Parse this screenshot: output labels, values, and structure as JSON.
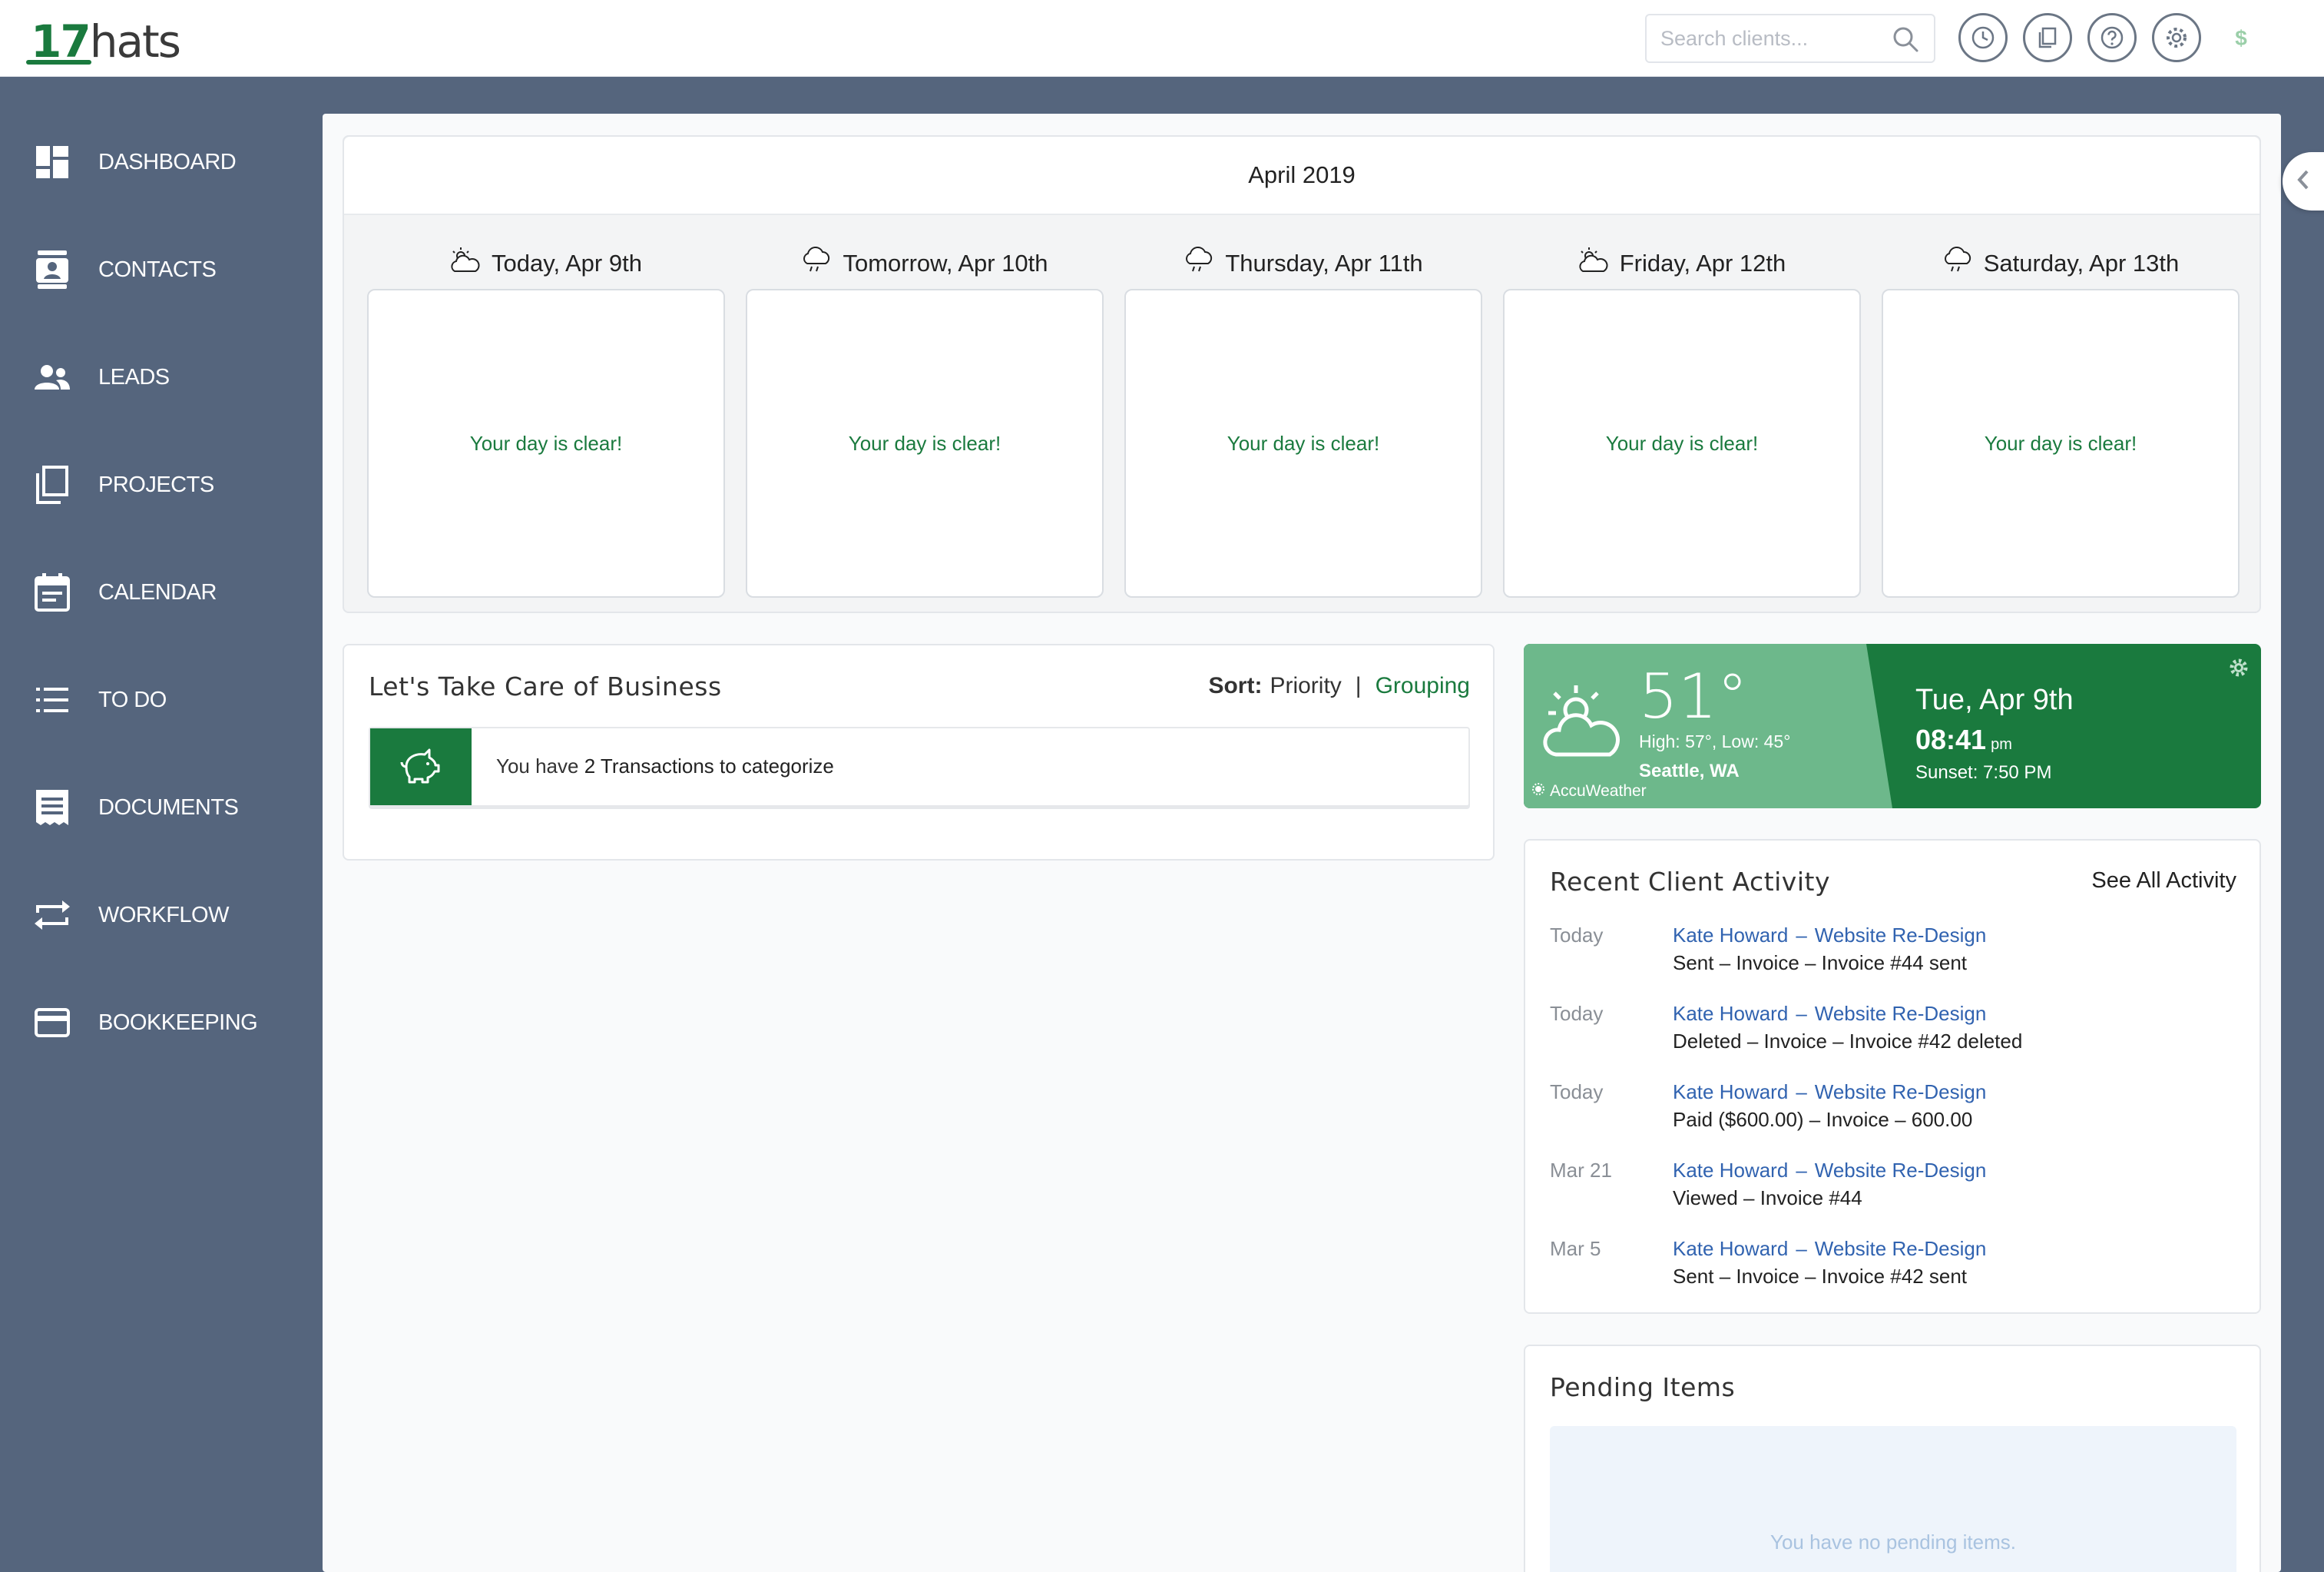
{
  "app": {
    "logo_number": "17",
    "logo_word": "hats"
  },
  "search": {
    "placeholder": "Search clients..."
  },
  "topbar_icons": [
    "clock-icon",
    "copy-icon",
    "help-icon",
    "settings-icon",
    "dollar-icon"
  ],
  "sidebar": {
    "items": [
      {
        "label": "DASHBOARD",
        "icon": "dashboard-icon"
      },
      {
        "label": "CONTACTS",
        "icon": "contacts-icon"
      },
      {
        "label": "LEADS",
        "icon": "leads-icon"
      },
      {
        "label": "PROJECTS",
        "icon": "projects-icon"
      },
      {
        "label": "CALENDAR",
        "icon": "calendar-icon"
      },
      {
        "label": "TO DO",
        "icon": "todo-icon"
      },
      {
        "label": "DOCUMENTS",
        "icon": "documents-icon"
      },
      {
        "label": "WORKFLOW",
        "icon": "workflow-icon"
      },
      {
        "label": "BOOKKEEPING",
        "icon": "bookkeeping-icon"
      }
    ]
  },
  "calendar": {
    "month": "April 2019",
    "days": [
      {
        "title": "Today, Apr 9th",
        "icon": "partly-sunny-icon",
        "message": "Your day is clear!"
      },
      {
        "title": "Tomorrow, Apr 10th",
        "icon": "rain-icon",
        "message": "Your day is clear!"
      },
      {
        "title": "Thursday, Apr 11th",
        "icon": "rain-icon",
        "message": "Your day is clear!"
      },
      {
        "title": "Friday, Apr 12th",
        "icon": "partly-sunny-icon",
        "message": "Your day is clear!"
      },
      {
        "title": "Saturday, Apr 13th",
        "icon": "rain-icon",
        "message": "Your day is clear!"
      }
    ]
  },
  "business": {
    "title": "Let's Take Care of Business",
    "sort_label": "Sort:",
    "sort_value": "Priority",
    "separator": "|",
    "grouping": "Grouping",
    "task_prefix": "You have ",
    "task_highlight": "2 Transactions to categorize"
  },
  "weather": {
    "temperature": "51°",
    "high_low": "High: 57°, Low: 45°",
    "city": "Seattle, WA",
    "provider": "AccuWeather",
    "date": "Tue, Apr 9th",
    "time": "08:41",
    "ampm": "pm",
    "sunset": "Sunset: 7:50 PM"
  },
  "activity": {
    "title": "Recent Client Activity",
    "see_all": "See All Activity",
    "items": [
      {
        "when": "Today",
        "client": "Kate Howard",
        "project": "Website Re-Design",
        "detail": "Sent  –  Invoice  –  Invoice #44 sent"
      },
      {
        "when": "Today",
        "client": "Kate Howard",
        "project": "Website Re-Design",
        "detail": "Deleted  –  Invoice  –  Invoice #42 deleted"
      },
      {
        "when": "Today",
        "client": "Kate Howard",
        "project": "Website Re-Design",
        "detail": "Paid ($600.00)  –  Invoice  –  600.00"
      },
      {
        "when": "Mar 21",
        "client": "Kate Howard",
        "project": "Website Re-Design",
        "detail": "Viewed  –  Invoice #44"
      },
      {
        "when": "Mar 5",
        "client": "Kate Howard",
        "project": "Website Re-Design",
        "detail": "Sent  –  Invoice  –  Invoice #42 sent"
      }
    ]
  },
  "pending": {
    "title": "Pending Items",
    "empty_message": "You have no pending items."
  },
  "colors": {
    "brand_green": "#1a7a3e",
    "sidebar_bg": "#55657d",
    "link_blue": "#3163b0",
    "weather_light": "#6db88b"
  }
}
